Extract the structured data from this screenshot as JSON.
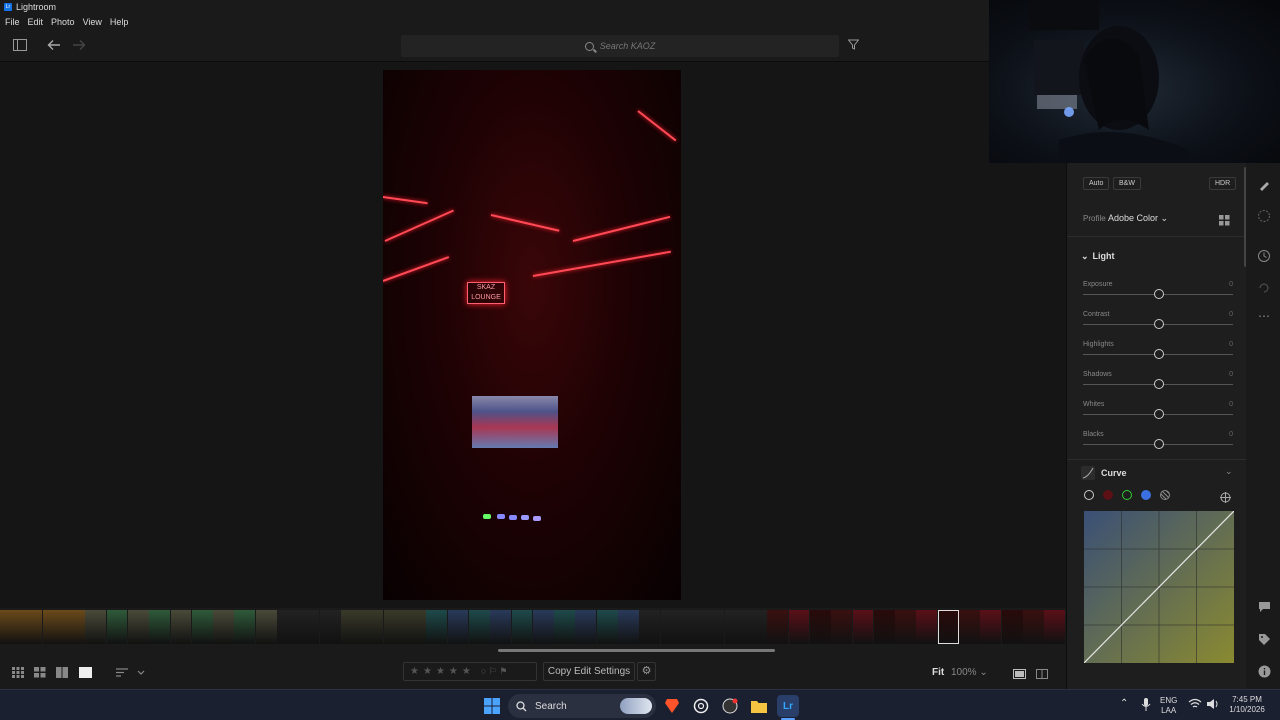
{
  "window": {
    "title": "Lightroom",
    "badge": "Lr"
  },
  "menu": [
    "File",
    "Edit",
    "Photo",
    "View",
    "Help"
  ],
  "search": {
    "placeholder": "Search KAOZ"
  },
  "photo": {
    "sign_line1": "SKAZ",
    "sign_line2": "LOUNGE"
  },
  "rating": {
    "stars": 5,
    "flags": "○ ⚐ ⚑"
  },
  "bottom": {
    "copy_label": "Copy Edit Settings",
    "fit_label": "Fit",
    "zoom_label": "100%"
  },
  "edit_panel": {
    "auto_label": "Auto",
    "bw_label": "B&W",
    "hdr_label": "HDR",
    "profile_label": "Profile",
    "profile_value": "Adobe Color",
    "light_section": "Light",
    "sliders": [
      {
        "label": "Exposure",
        "value": "0"
      },
      {
        "label": "Contrast",
        "value": "0"
      },
      {
        "label": "Highlights",
        "value": "0"
      },
      {
        "label": "Shadows",
        "value": "0"
      },
      {
        "label": "Whites",
        "value": "0"
      },
      {
        "label": "Blacks",
        "value": "0"
      }
    ],
    "curve_section": "Curve"
  },
  "taskbar": {
    "search_label": "Search",
    "lang_line1": "ENG",
    "lang_line2": "LAA",
    "time": "7:45 PM",
    "date": "1/10/2026"
  },
  "colors": {
    "accent": "#1473e6",
    "panel": "#1e1e1e",
    "photo_red": "#ff4a55"
  }
}
